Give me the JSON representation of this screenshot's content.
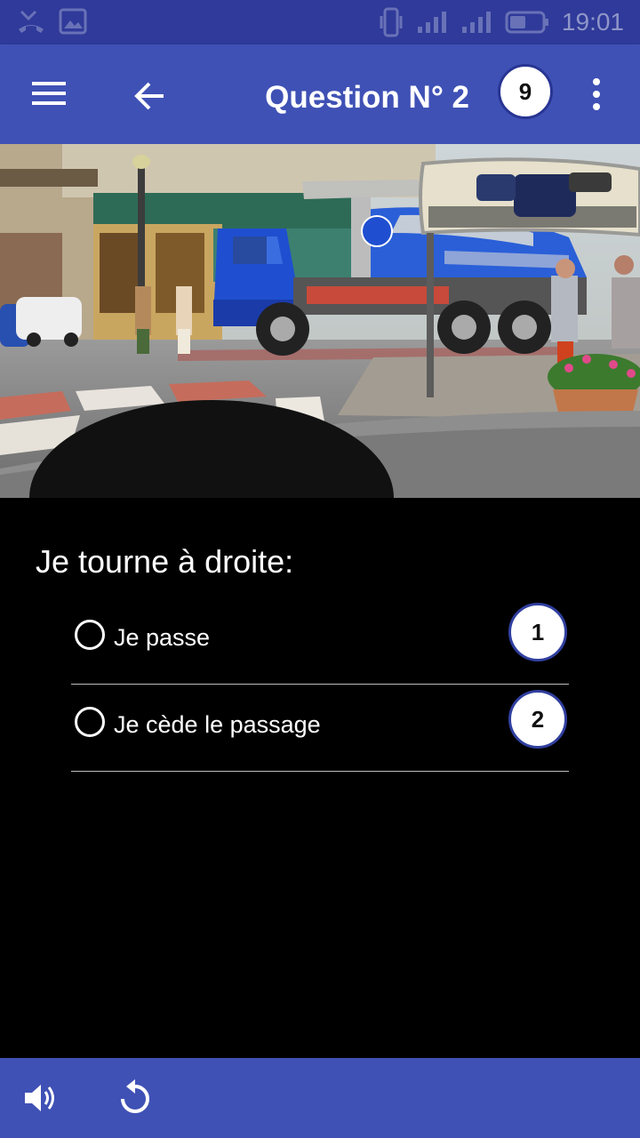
{
  "status_bar": {
    "time": "19:01",
    "icons": [
      "missed-call-icon",
      "image-icon",
      "vibrate-icon",
      "signal-icon",
      "signal-icon",
      "battery-icon"
    ]
  },
  "app_bar": {
    "title": "Question N° 2",
    "count_badge": "9",
    "icons": [
      "menu-icon",
      "back-arrow-icon",
      "more-vert-icon"
    ]
  },
  "question": {
    "text": "Je tourne à droite:",
    "answers": [
      {
        "label": "Je passe",
        "number": "1"
      },
      {
        "label": "Je cède le passage",
        "number": "2"
      }
    ]
  },
  "bottom_bar": {
    "icons": [
      "speaker-icon",
      "replay-icon"
    ]
  },
  "colors": {
    "primary": "#3f51b5",
    "status_bar": "#2f3a9a",
    "background": "#000000",
    "truck_blue": "#1f4fd0"
  }
}
